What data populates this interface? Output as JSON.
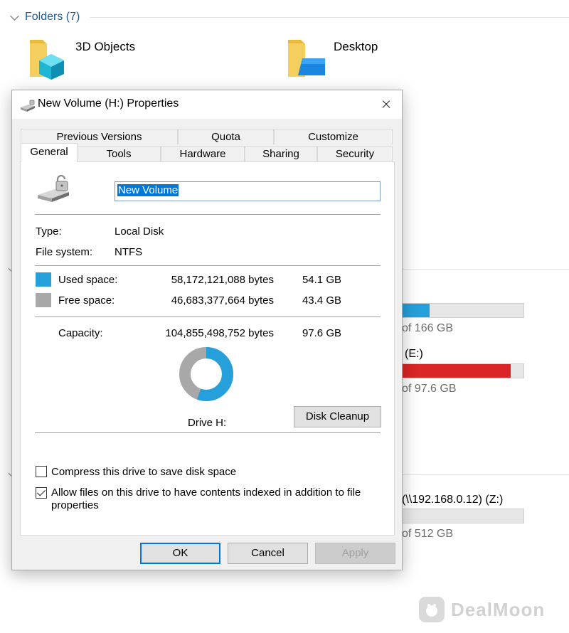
{
  "explorer": {
    "folders_header": "Folders (7)",
    "folders": [
      {
        "name": "3D Objects",
        "icon": "3d-objects-folder-icon"
      },
      {
        "name": "Desktop",
        "icon": "desktop-folder-icon"
      }
    ],
    "drives": [
      {
        "name": "",
        "free_text": "of 166 GB",
        "used_fraction": 0.26,
        "bar_color": "#26a0da"
      },
      {
        "name": "(E:)",
        "free_text": "of 97.6 GB",
        "used_fraction": 0.9,
        "bar_color": "#da2626"
      },
      {
        "name": "(\\\\192.168.0.12) (Z:)",
        "free_text": "of 512 GB",
        "used_fraction": 0.0,
        "bar_color": "#26a0da"
      }
    ],
    "watermark": "DealMoon"
  },
  "dialog": {
    "title": "New Volume (H:) Properties",
    "tabs_row1": [
      "Previous Versions",
      "Quota",
      "Customize"
    ],
    "tabs_row2": [
      "General",
      "Tools",
      "Hardware",
      "Sharing",
      "Security"
    ],
    "active_tab": "General",
    "volume_name": "New Volume",
    "type_label": "Type:",
    "type_value": "Local Disk",
    "fs_label": "File system:",
    "fs_value": "NTFS",
    "used_label": "Used space:",
    "used_bytes": "58,172,121,088 bytes",
    "used_gb": "54.1 GB",
    "free_label": "Free space:",
    "free_bytes": "46,683,377,664 bytes",
    "free_gb": "43.4 GB",
    "capacity_label": "Capacity:",
    "capacity_bytes": "104,855,498,752 bytes",
    "capacity_gb": "97.6 GB",
    "used_fraction": 0.555,
    "used_color": "#26a0da",
    "free_color": "#a8a8a8",
    "drive_label": "Drive H:",
    "disk_cleanup_label": "Disk Cleanup",
    "compress_label": "Compress this drive to save disk space",
    "compress_checked": false,
    "index_label": "Allow files on this drive to have contents indexed in addition to file properties",
    "index_checked": true,
    "ok_label": "OK",
    "cancel_label": "Cancel",
    "apply_label": "Apply"
  }
}
